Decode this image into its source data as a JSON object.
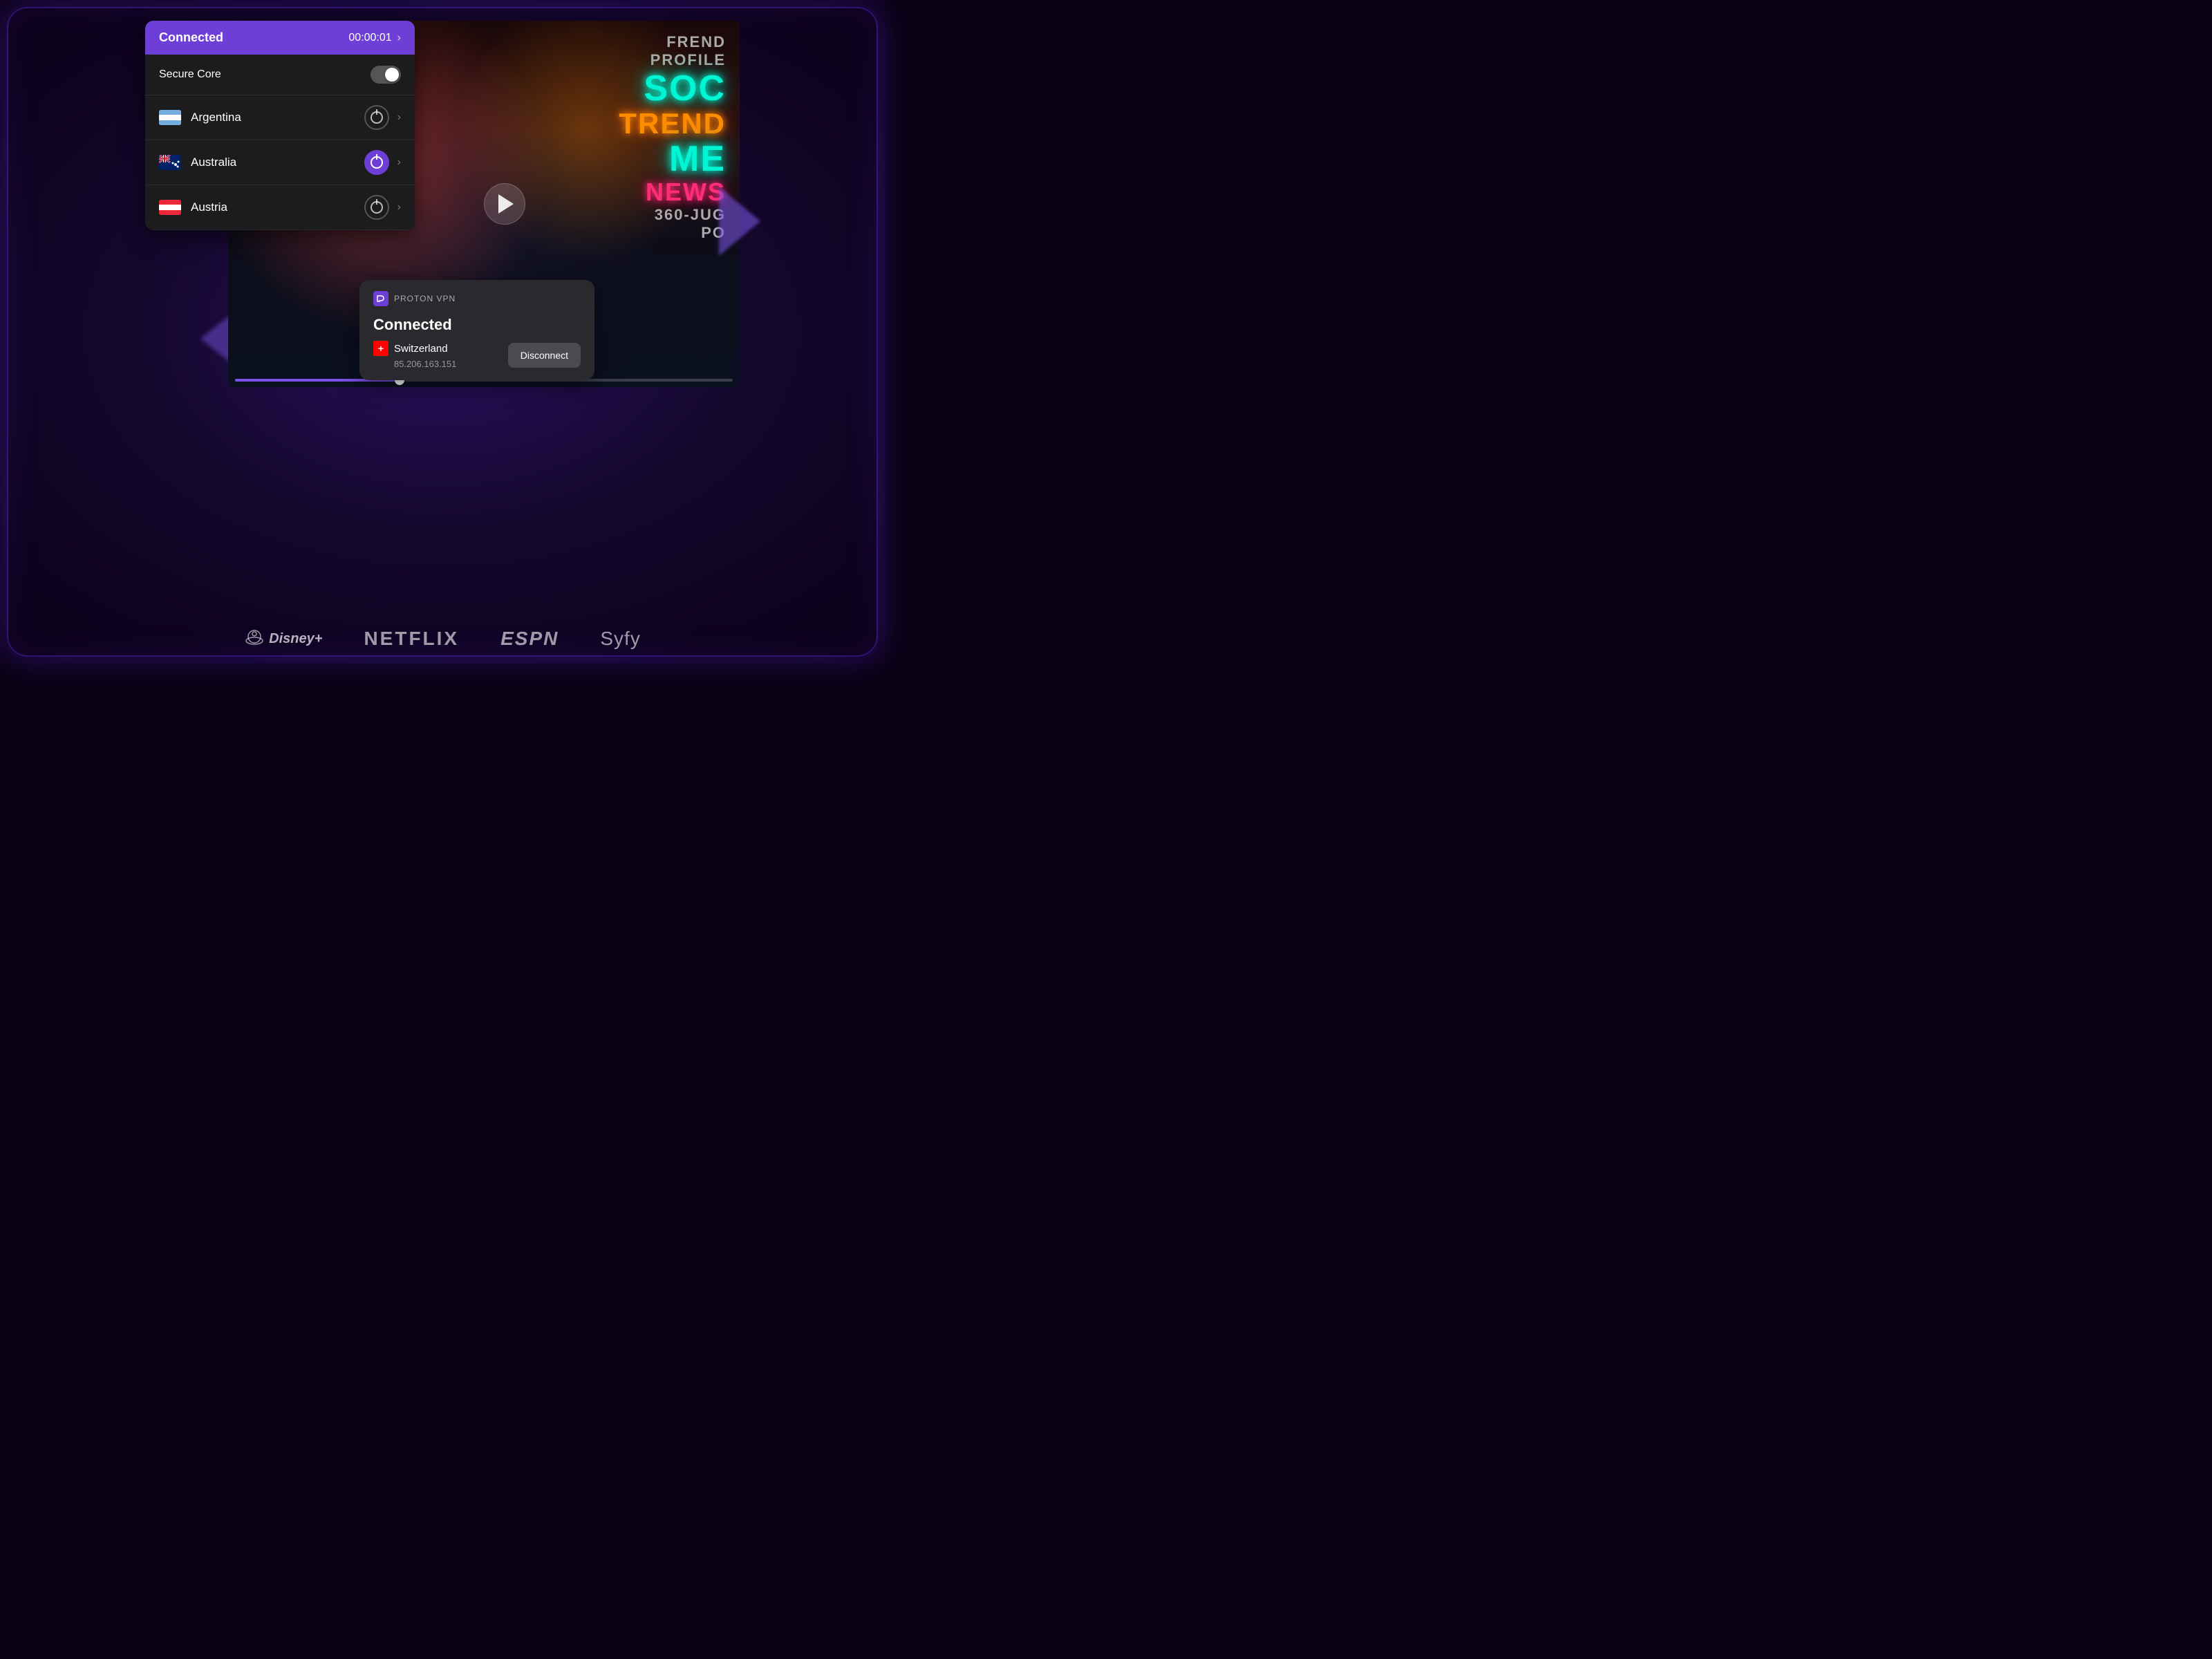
{
  "background": {
    "gradient_start": "#0a0014",
    "gradient_end": "#2a1060"
  },
  "vpn_panel": {
    "header": {
      "status": "Connected",
      "timer": "00:00:01",
      "chevron": "›"
    },
    "secure_core": {
      "label": "Secure Core",
      "toggle_on": false
    },
    "countries": [
      {
        "name": "Argentina",
        "flag_code": "ar",
        "active": false
      },
      {
        "name": "Australia",
        "flag_code": "au",
        "active": true
      },
      {
        "name": "Austria",
        "flag_code": "at",
        "active": false
      }
    ]
  },
  "notification": {
    "app_name": "PROTON VPN",
    "status": "Connected",
    "country": "Switzerland",
    "ip": "85.206.163.151",
    "disconnect_label": "Disconnect"
  },
  "video": {
    "neon_lines": [
      "SOC",
      "ME"
    ],
    "other_text": [
      "FREND",
      "PROFILE",
      "TREND",
      "NEWS",
      "PO"
    ]
  },
  "streaming_logos": [
    {
      "name": "Disney+",
      "key": "disney"
    },
    {
      "name": "NETFLIX",
      "key": "netflix"
    },
    {
      "name": "ESPN",
      "key": "espn"
    },
    {
      "name": "Syfy",
      "key": "syfy"
    }
  ]
}
